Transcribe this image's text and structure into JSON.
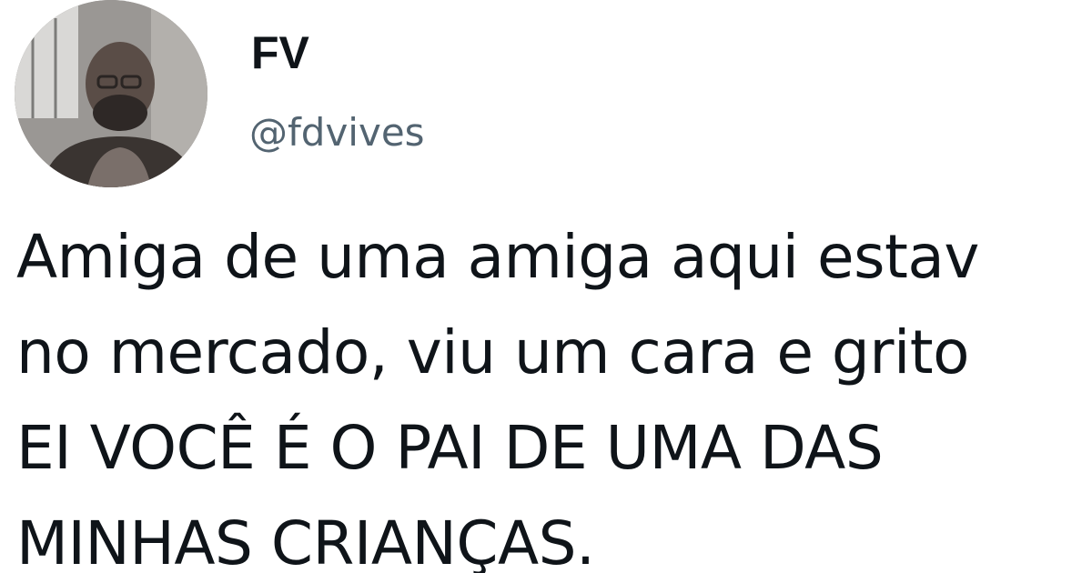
{
  "tweet": {
    "author": {
      "display_name": "FV",
      "handle": "@fdvives",
      "avatar_icon": "profile-photo-avatar"
    },
    "text_lines": [
      "Amiga de uma amiga aqui estav",
      "no mercado, viu um cara e grito",
      "EI VOCÊ É O PAI DE UMA DAS",
      "MINHAS CRIANÇAS."
    ]
  },
  "colors": {
    "background": "#ffffff",
    "text": "#0f1419",
    "handle": "#536471"
  }
}
